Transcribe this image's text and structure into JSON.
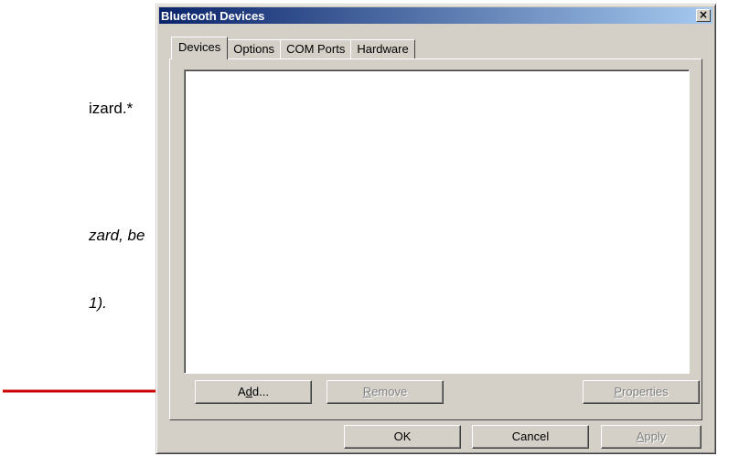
{
  "background": {
    "line1": "izard.*",
    "line2": "zard, be",
    "line3": "1)."
  },
  "colors": {
    "arrow": "#cc0000",
    "title_start": "#0a246a",
    "title_end": "#a6caf0",
    "dialog_face": "#d4d0c8"
  },
  "dialog": {
    "title": "Bluetooth Devices",
    "close_label": "×",
    "tabs": [
      {
        "label": "Devices",
        "active": true
      },
      {
        "label": "Options",
        "active": false
      },
      {
        "label": "COM Ports",
        "active": false
      },
      {
        "label": "Hardware",
        "active": false
      }
    ],
    "device_list": [],
    "buttons": {
      "add": {
        "pre": "A",
        "underline": "d",
        "post": "d...",
        "enabled": true
      },
      "remove": {
        "pre": "",
        "underline": "R",
        "post": "emove",
        "enabled": false
      },
      "properties": {
        "pre": "",
        "underline": "P",
        "post": "roperties",
        "enabled": false
      },
      "ok": {
        "label": "OK",
        "enabled": true
      },
      "cancel": {
        "label": "Cancel",
        "enabled": true
      },
      "apply": {
        "pre": "",
        "underline": "A",
        "post": "pply",
        "enabled": false
      }
    }
  }
}
